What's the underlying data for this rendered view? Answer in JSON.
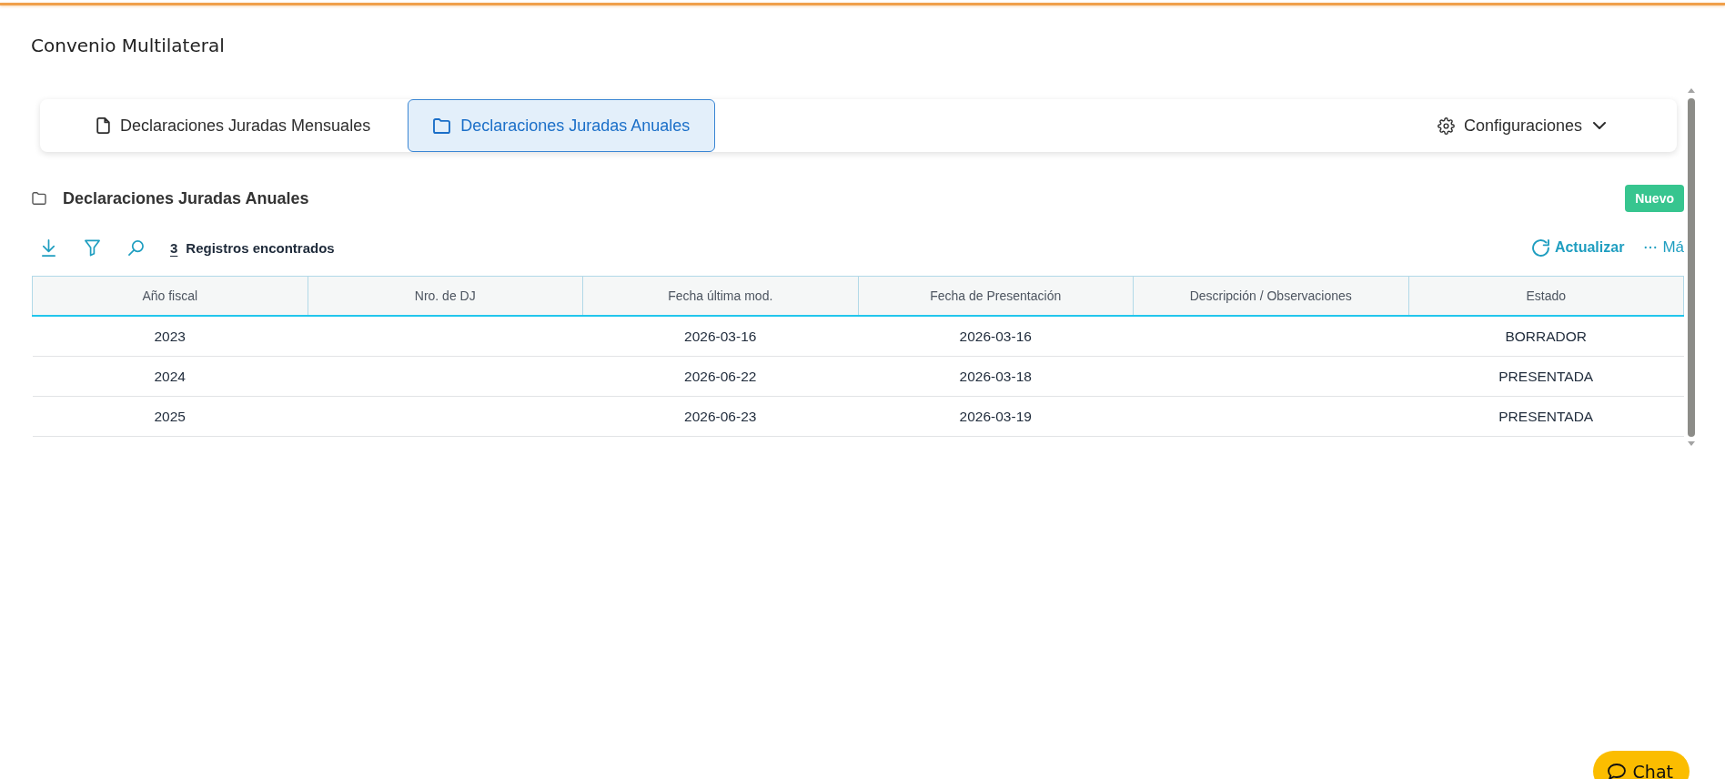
{
  "page": {
    "title": "Convenio Multilateral"
  },
  "tabs": [
    {
      "label": "Declaraciones Juradas Mensuales",
      "selected": false
    },
    {
      "label": "Declaraciones Juradas Anuales",
      "selected": true
    }
  ],
  "settings_menu": {
    "label": "Configuraciones"
  },
  "section": {
    "title": "Declaraciones Juradas Anuales",
    "new_button": "Nuevo"
  },
  "toolbar": {
    "record_count": "3",
    "record_label": "Registros encontrados",
    "refresh_button": "Actualizar",
    "more_button": "Má"
  },
  "table": {
    "columns": [
      "Año fiscal",
      "Nro. de DJ",
      "Fecha última mod.",
      "Fecha de Presentación",
      "Descripción / Observaciones",
      "Estado"
    ],
    "rows": [
      {
        "fiscal_year": "2023",
        "last_modified": "2026-03-16",
        "submitted": "2026-03-16",
        "status": "BORRADOR"
      },
      {
        "fiscal_year": "2024",
        "last_modified": "2026-06-22",
        "submitted": "2026-03-18",
        "status": "PRESENTADA"
      },
      {
        "fiscal_year": "2025",
        "last_modified": "2026-06-23",
        "submitted": "2026-03-19",
        "status": "PRESENTADA"
      }
    ]
  },
  "chat_button": {
    "label": "Chat"
  }
}
